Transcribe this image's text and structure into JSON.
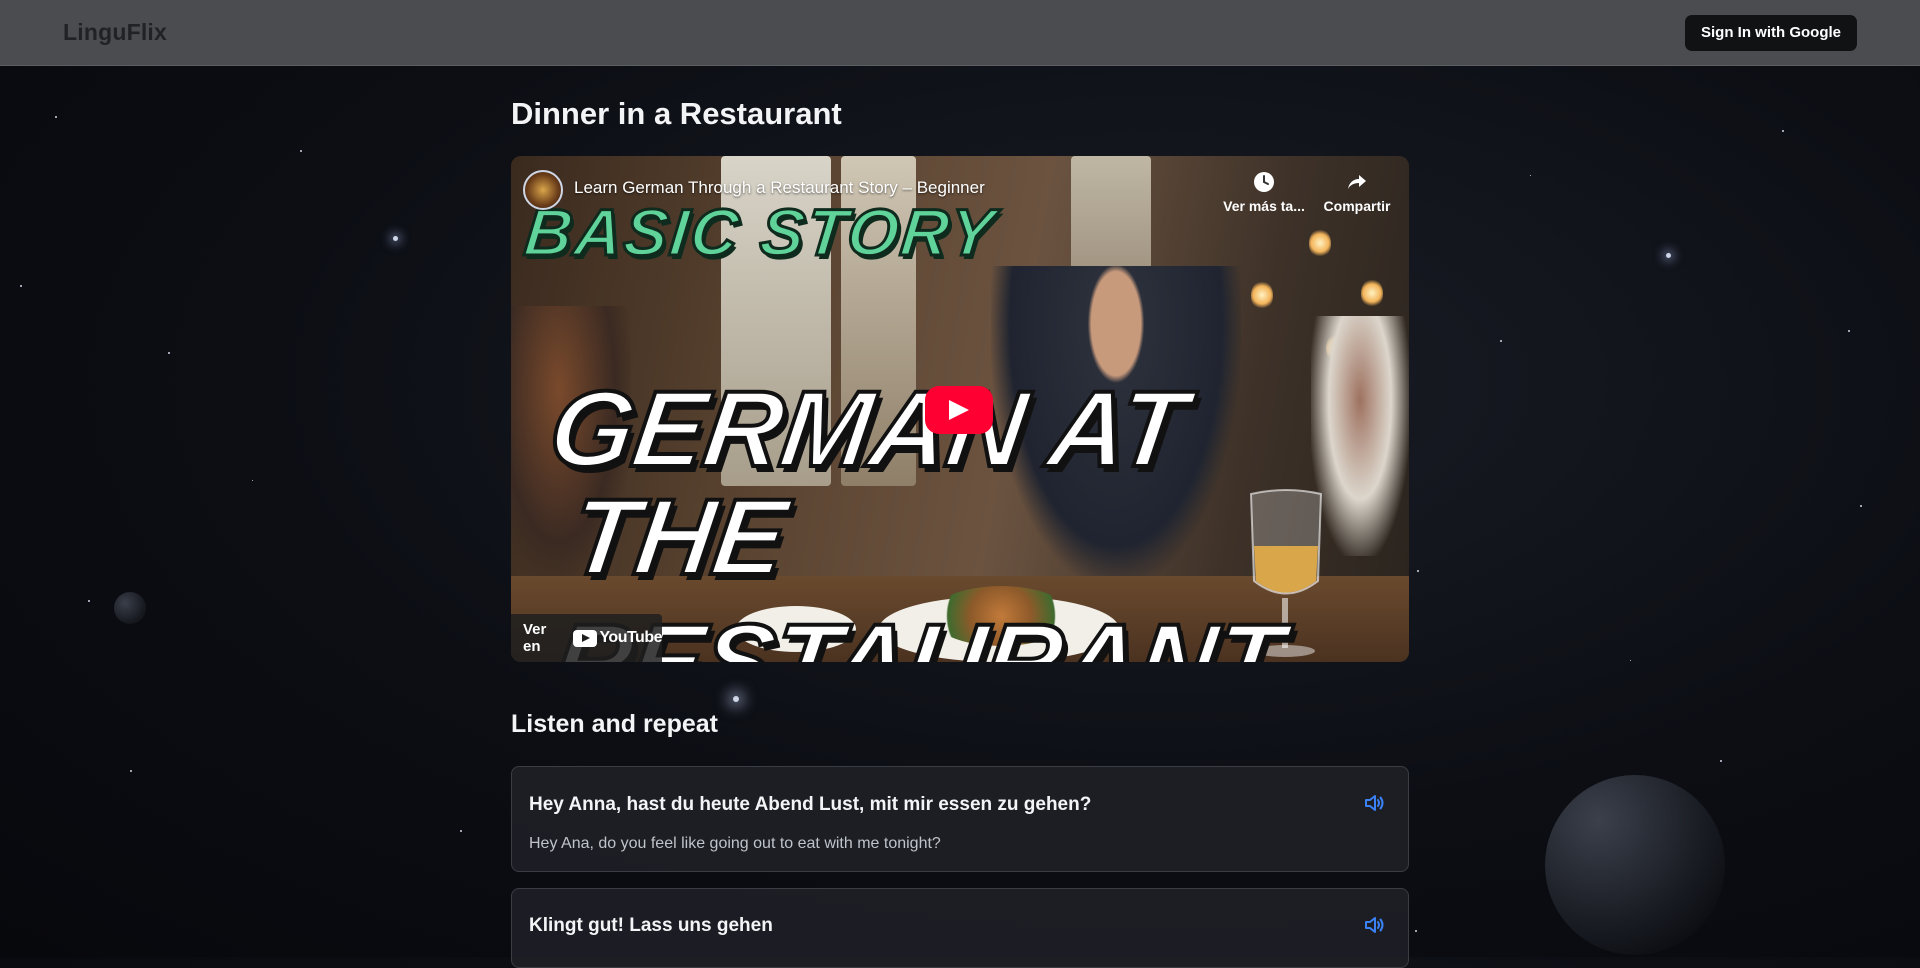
{
  "app": {
    "brand": "LinguFlix"
  },
  "header": {
    "signin_label": "Sign In with Google"
  },
  "page": {
    "title": "Dinner in a Restaurant"
  },
  "video": {
    "title": "Learn German Through a Restaurant Story – Beginner",
    "watch_later_label": "Ver más ta...",
    "share_label": "Compartir",
    "watch_on_label": "Ver en",
    "youtube_label": "YouTube",
    "thumbnail": {
      "tagline": "BASIC STORY",
      "line1": "GERMAN AT",
      "line2": "THE RESTAURANT"
    }
  },
  "section": {
    "title": "Listen and repeat"
  },
  "phrases": [
    {
      "german": "Hey Anna, hast du heute Abend Lust, mit mir essen zu gehen?",
      "english": "Hey Ana, do you feel like going out to eat with me tonight?"
    },
    {
      "german": "Klingt gut! Lass uns gehen",
      "english": ""
    }
  ],
  "colors": {
    "accent_blue": "#3b82f6",
    "youtube_red": "#ff0033",
    "topbar": "#4a4c50",
    "tagline_green": "#5fd39a"
  },
  "icons": {
    "watch_later": "clock-icon",
    "share": "share-arrow-icon",
    "play": "play-icon",
    "speaker": "speaker-icon"
  }
}
